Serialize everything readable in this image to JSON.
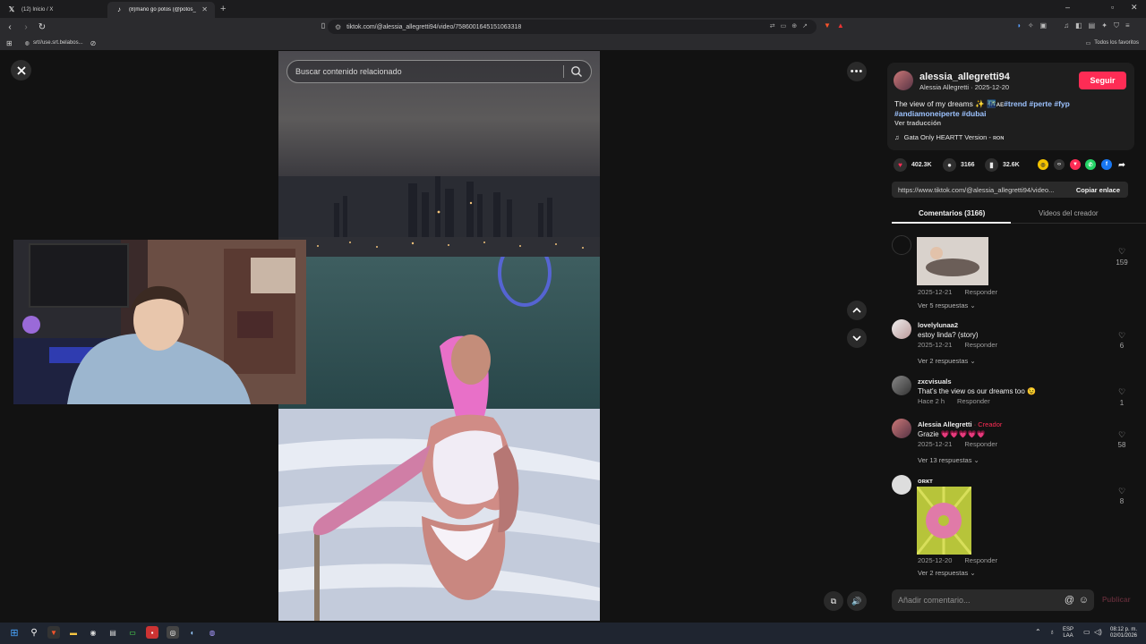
{
  "browser": {
    "tabs": [
      {
        "label": "(12) Inicio / X",
        "icon": "x-logo-icon"
      },
      {
        "label": "(8)mano go potos (@potos_",
        "icon": "tiktok-icon"
      }
    ],
    "url": "tiktok.com/@alessia_allegretti94/video/7586001645151063318",
    "bookmarks": [
      {
        "label": "srt//use.srt.belabos..."
      }
    ],
    "bookmarks_right": "Todos los favoritos"
  },
  "search": {
    "placeholder": "Buscar contenido relacionado"
  },
  "post": {
    "username": "alessia_allegretti94",
    "subtitle": "Alessia Allegretti · 2025-12-20",
    "follow_label": "Seguir",
    "description_plain": "The view of my dreams ✨ 🌃ᴀᴇ",
    "hashtags_line1": "#trend #perte #fyp",
    "hashtags_line2": "#andiamoneiperte #dubai",
    "translate": "Ver traducción",
    "music": "Gata Only HEARTT Version - ʀᴏɴ"
  },
  "stats": {
    "likes": "402.3K",
    "comments": "3166",
    "saves": "32.6K"
  },
  "link": {
    "url": "https://www.tiktok.com/@alessia_allegretti94/video...",
    "copy_label": "Copiar enlace"
  },
  "comment_tabs": {
    "comments": "Comentarios (3166)",
    "creator": "Videos del creador"
  },
  "comments": [
    {
      "name": "",
      "text": "",
      "date": "2025-12-21",
      "reply": "Responder",
      "more": "Ver 5 respuestas",
      "likes": "159"
    },
    {
      "name": "lovelylunaa2",
      "text": "estoy linda? (story)",
      "date": "2025-12-21",
      "reply": "Responder",
      "more": "Ver 2 respuestas",
      "likes": "6"
    },
    {
      "name": "zxcvisuals",
      "text": "That's the view os our dreams too 😉",
      "date": "Hace 2 h",
      "reply": "Responder",
      "more": "",
      "likes": "1"
    },
    {
      "name": "Alessia Allegretti",
      "creator_tag": "· Creador",
      "text": "Grazie 💗💗💗💗💗",
      "date": "2025-12-21",
      "reply": "Responder",
      "more": "Ver 13 respuestas",
      "likes": "58"
    },
    {
      "name": "ᴏʀᴋᴛ",
      "text": "",
      "date": "2025-12-20",
      "reply": "Responder",
      "more": "Ver 2 respuestas",
      "likes": "8"
    }
  ],
  "comment_input": {
    "placeholder": "Añadir comentario...",
    "post_label": "Publicar"
  },
  "taskbar": {
    "lang_top": "ESP",
    "lang_bottom": "LAA",
    "time": "08:12 p. m.",
    "date": "02/01/2026"
  }
}
